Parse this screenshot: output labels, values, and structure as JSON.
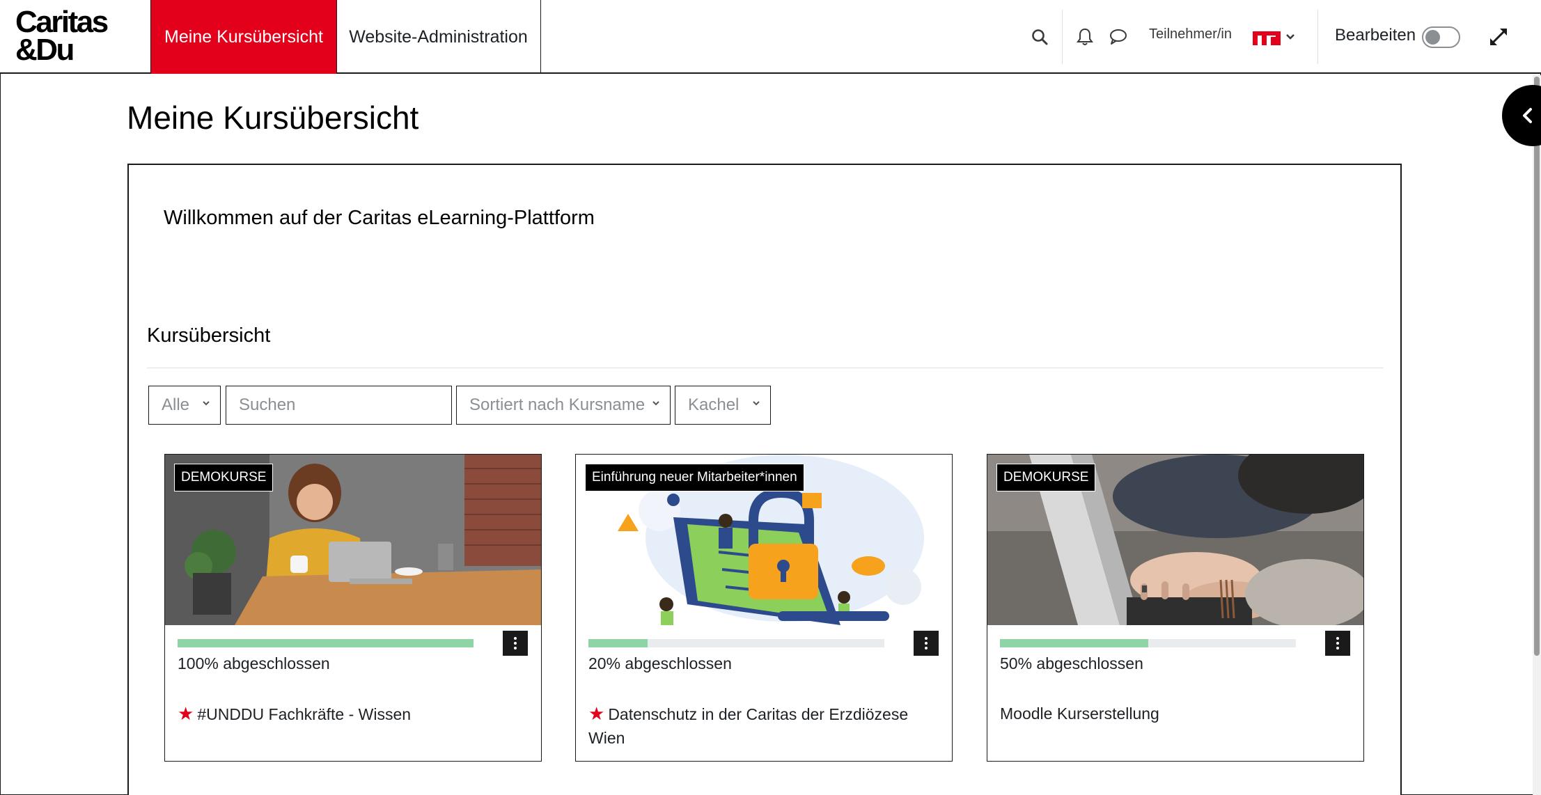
{
  "brand": {
    "line1": "Caritas",
    "line2": "&Du",
    "accent": "#e2001a"
  },
  "nav": {
    "tabs": [
      {
        "label": "Meine Kursübersicht",
        "active": true
      },
      {
        "label": "Website-Administration",
        "active": false
      }
    ],
    "icons": [
      "search-icon",
      "bell-icon",
      "chat-icon",
      "chevron-down-icon"
    ],
    "role": "Teilnehmer/in",
    "edit_label": "Bearbeiten",
    "edit_mode": false
  },
  "page": {
    "title": "Meine Kursübersicht"
  },
  "block": {
    "welcome": "Willkommen auf der Caritas eLearning-Plattform",
    "section_title": "Kursübersicht",
    "filters": {
      "grouping": "Alle",
      "search_placeholder": "Suchen",
      "sort": "Sortiert nach Kursname",
      "view": "Kachel"
    }
  },
  "courses": [
    {
      "category": "DEMOKURSE",
      "progress_text": "100% abgeschlossen",
      "progress": 100,
      "name": "#UNDDU Fachkräfte - Wissen",
      "starred": true,
      "progress_color": "#8ed4a4"
    },
    {
      "category": "Einführung neuer Mitarbeiter*innen",
      "progress_text": "20% abgeschlossen",
      "progress": 20,
      "name": "Datenschutz in der Caritas der Erzdiözese Wien",
      "starred": true,
      "progress_color": "#8ed4a4"
    },
    {
      "category": "DEMOKURSE",
      "progress_text": "50% abgeschlossen",
      "progress": 50,
      "name": "Moodle Kurserstellung",
      "starred": false,
      "progress_color": "#8ed4a4"
    }
  ]
}
